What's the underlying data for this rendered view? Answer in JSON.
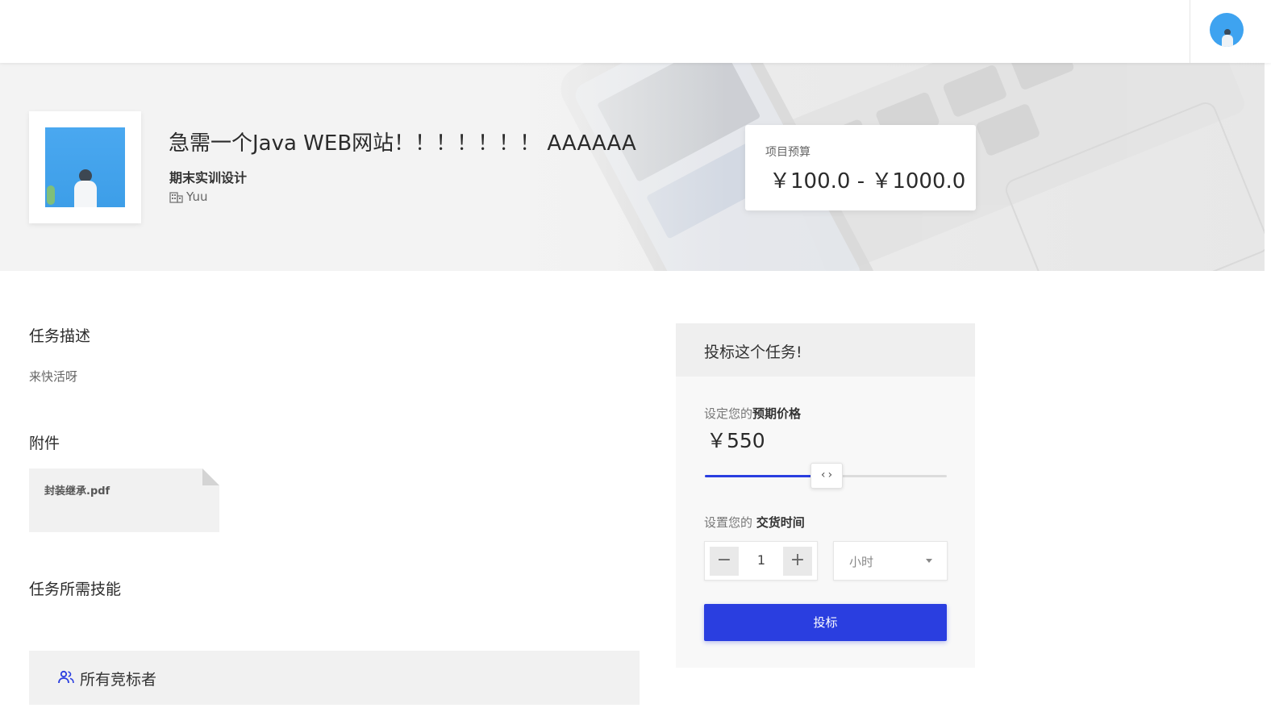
{
  "header": {
    "avatar_icon": "user-avatar"
  },
  "project": {
    "title": "急需一个Java WEB网站！！！！！！！ AAAAAA",
    "category": "期末实训设计",
    "owner": "Yuu",
    "owner_icon": "building-icon"
  },
  "budget": {
    "label": "项目预算",
    "range": "￥100.0 - ￥1000.0"
  },
  "description": {
    "heading": "任务描述",
    "text": "来快活呀"
  },
  "attachments": {
    "heading": "附件",
    "files": [
      {
        "name": "封装继承.pdf"
      }
    ]
  },
  "skills": {
    "heading": "任务所需技能"
  },
  "bidders": {
    "label": "所有竞标者",
    "icon": "people-icon"
  },
  "bid": {
    "title": "投标这个任务!",
    "price_label_prefix": "设定您的",
    "price_label_bold": "预期价格",
    "price_value": "￥550",
    "slider": {
      "min": 100,
      "max": 1000,
      "value": 550
    },
    "time_label_prefix": "设置您的 ",
    "time_label_bold": "交货时间",
    "quantity": "1",
    "unit": "小时",
    "submit_label": "投标"
  },
  "colors": {
    "accent": "#2a3ee0",
    "avatar": "#3ea3f0"
  }
}
